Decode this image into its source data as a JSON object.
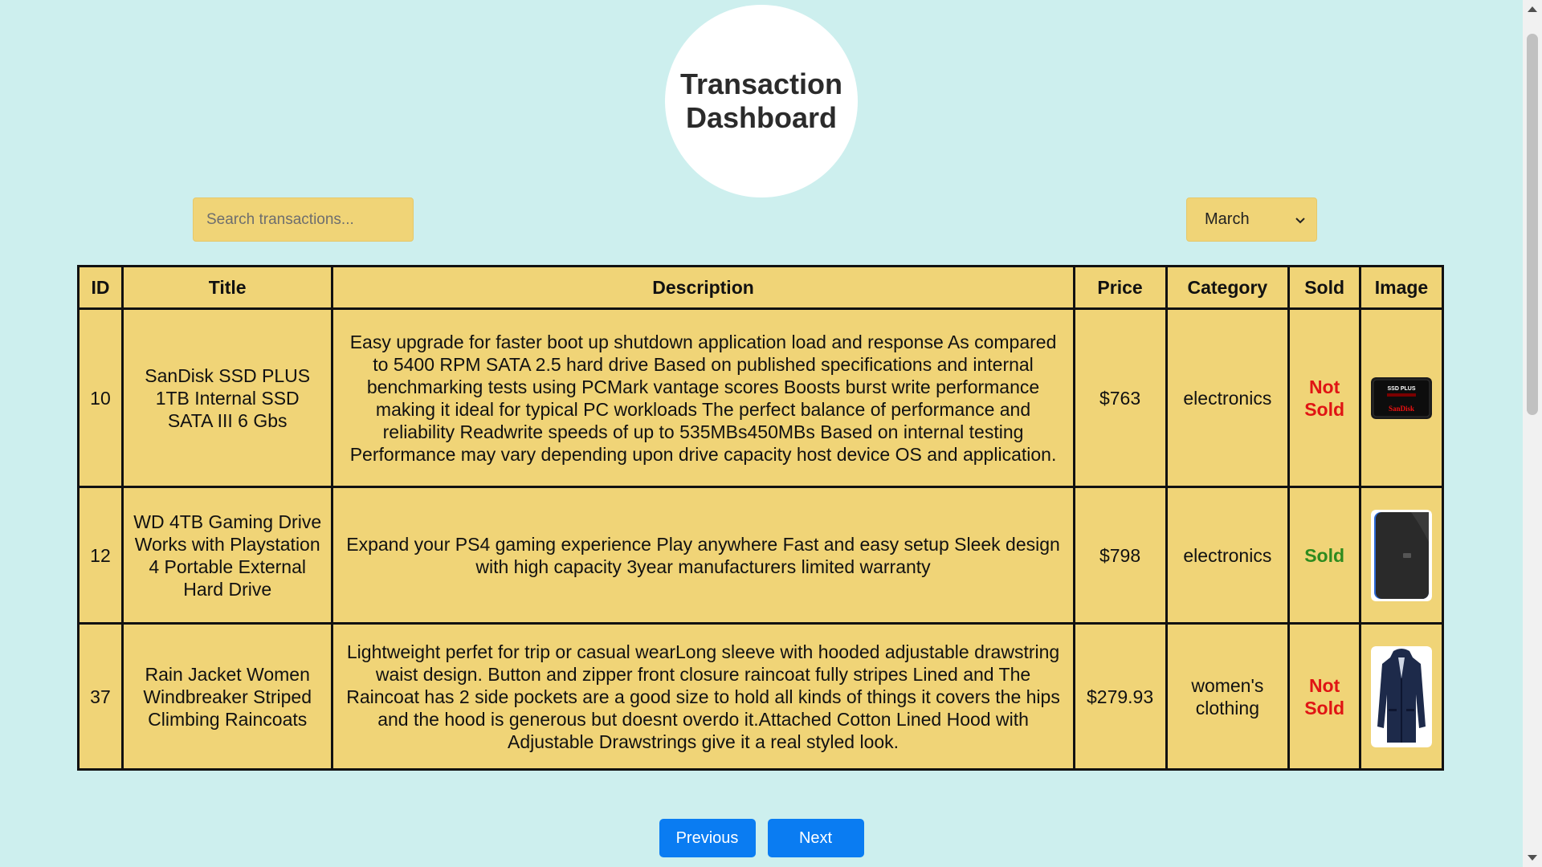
{
  "header": {
    "title": "Transaction Dashboard"
  },
  "search": {
    "placeholder": "Search transactions...",
    "value": ""
  },
  "month_filter": {
    "selected": "March"
  },
  "table": {
    "columns": [
      "ID",
      "Title",
      "Description",
      "Price",
      "Category",
      "Sold",
      "Image"
    ],
    "rows": [
      {
        "id": "10",
        "title": "SanDisk SSD PLUS 1TB Internal SSD SATA III 6 Gbs",
        "description": "Easy upgrade for faster boot up shutdown application load and response As compared to 5400 RPM SATA 2.5 hard drive Based on published specifications and internal benchmarking tests using PCMark vantage scores Boosts burst write performance making it ideal for typical PC workloads The perfect balance of performance and reliability Readwrite speeds of up to 535MBs450MBs Based on internal testing Performance may vary depending upon drive capacity host device OS and application.",
        "price": "$763",
        "category": "electronics",
        "sold": "Not Sold",
        "image_icon": "ssd-product-image",
        "image_label_top": "SSD PLUS",
        "image_label_brand": "SanDisk"
      },
      {
        "id": "12",
        "title": "WD 4TB Gaming Drive Works with Playstation 4 Portable External Hard Drive",
        "description": "Expand your PS4 gaming experience Play anywhere Fast and easy setup Sleek design with high capacity 3year manufacturers limited warranty",
        "price": "$798",
        "category": "electronics",
        "sold": "Sold",
        "image_icon": "hard-drive-product-image"
      },
      {
        "id": "37",
        "title": "Rain Jacket Women Windbreaker Striped Climbing Raincoats",
        "description": "Lightweight perfet for trip or casual wearLong sleeve with hooded adjustable drawstring waist design. Button and zipper front closure raincoat fully stripes Lined and The Raincoat has 2 side pockets are a good size to hold all kinds of things it covers the hips and the hood is generous but doesnt overdo it.Attached Cotton Lined Hood with Adjustable Drawstrings give it a real styled look.",
        "price": "$279.93",
        "category": "women's clothing",
        "sold": "Not Sold",
        "image_icon": "raincoat-product-image"
      }
    ]
  },
  "pagination": {
    "previous_label": "Previous",
    "next_label": "Next"
  },
  "colors": {
    "background": "#cdefee",
    "table_fill": "#f0d477",
    "button_blue": "#0a7cf2",
    "sold_green": "#2e8b1e",
    "not_sold_red": "#e01414"
  }
}
